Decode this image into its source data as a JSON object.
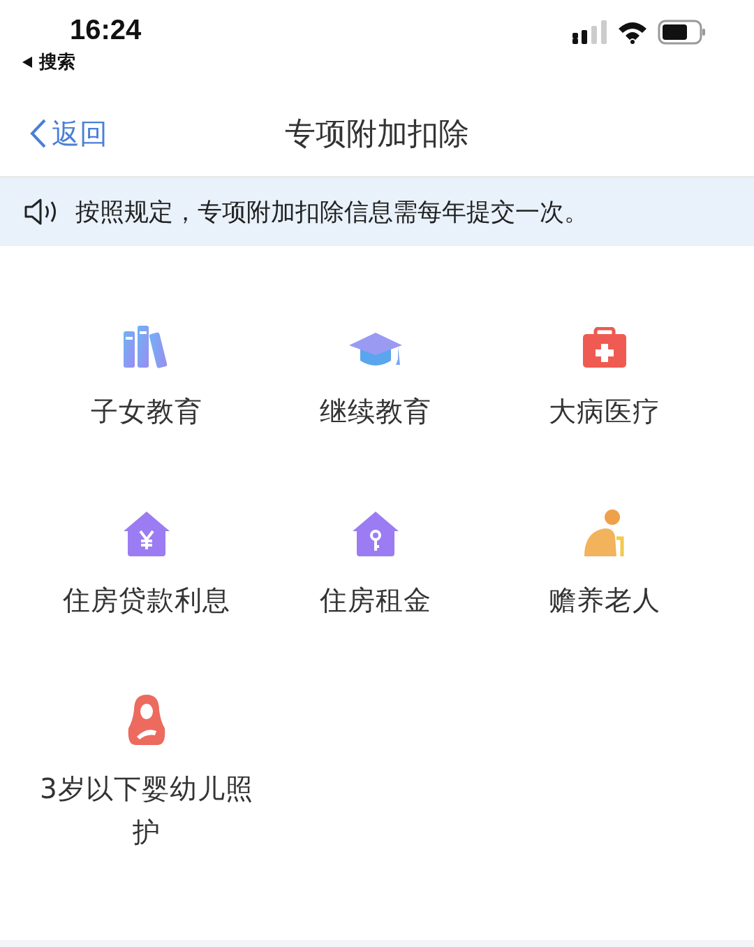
{
  "status_bar": {
    "time": "16:24",
    "back_app": "搜索"
  },
  "nav": {
    "back": "返回",
    "title": "专项附加扣除"
  },
  "notice": {
    "text": "按照规定，专项附加扣除信息需每年提交一次。"
  },
  "items": [
    {
      "kind": "books",
      "label": "子女教育"
    },
    {
      "kind": "cap",
      "label": "继续教育"
    },
    {
      "kind": "medkit",
      "label": "大病医疗"
    },
    {
      "kind": "house-yen",
      "label": "住房贷款利息"
    },
    {
      "kind": "house-key",
      "label": "住房租金"
    },
    {
      "kind": "elder",
      "label": "赡养老人"
    },
    {
      "kind": "mother",
      "label": "3岁以下婴幼儿照护"
    }
  ]
}
